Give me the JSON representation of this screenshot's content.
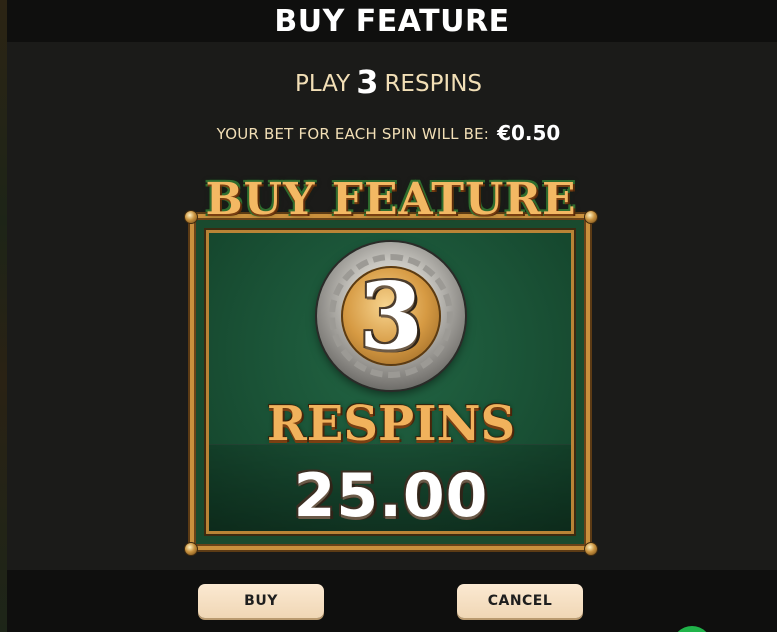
{
  "header": {
    "title": "BUY FEATURE"
  },
  "dialog": {
    "play_prefix": "PLAY",
    "respin_count": "3",
    "play_suffix": "RESPINS",
    "bet_label": "YOUR BET FOR EACH SPIN WILL BE:",
    "bet_value": "€0.50"
  },
  "panel": {
    "title": "BUY FEATURE",
    "coin_number": "3",
    "respins_label": "RESPINS",
    "price": "25.00"
  },
  "buttons": {
    "buy_label": "BUY",
    "cancel_label": "CANCEL"
  },
  "colors": {
    "accent_cream": "#f2dfb6",
    "button_bg": "#f0d7b5",
    "panel_green": "#1a5236",
    "gold": "#c9903d"
  }
}
